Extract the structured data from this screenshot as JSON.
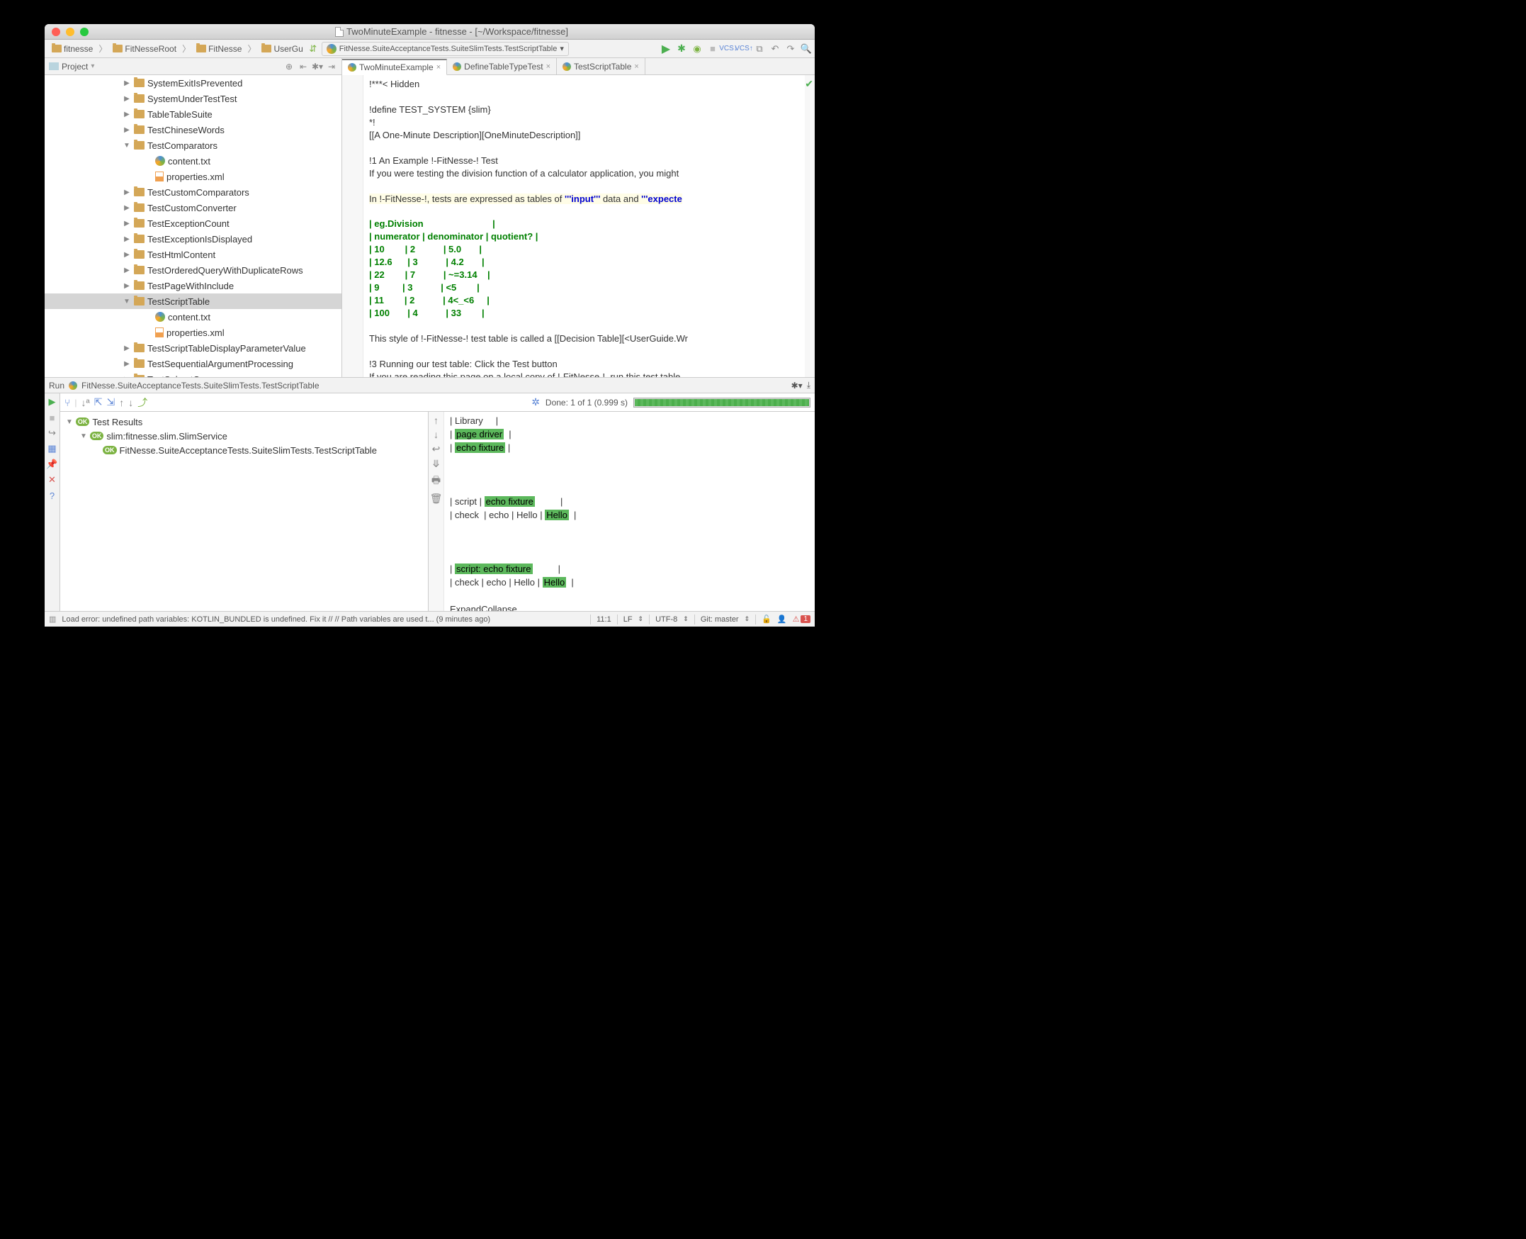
{
  "title": "TwoMinuteExample - fitnesse - [~/Workspace/fitnesse]",
  "breadcrumbs": [
    "fitnesse",
    "FitNesseRoot",
    "FitNesse",
    "UserGu"
  ],
  "runConfig": "FitNesse.SuiteAcceptanceTests.SuiteSlimTests.TestScriptTable",
  "projectPanel": {
    "label": "Project"
  },
  "tree": [
    {
      "indent": 110,
      "kind": "fold",
      "arrow": "▶",
      "name": "SystemExitIsPrevented"
    },
    {
      "indent": 110,
      "kind": "fold",
      "arrow": "▶",
      "name": "SystemUnderTestTest"
    },
    {
      "indent": 110,
      "kind": "fold",
      "arrow": "▶",
      "name": "TableTableSuite"
    },
    {
      "indent": 110,
      "kind": "fold",
      "arrow": "▶",
      "name": "TestChineseWords"
    },
    {
      "indent": 110,
      "kind": "fold",
      "arrow": "▼",
      "name": "TestComparators"
    },
    {
      "indent": 140,
      "kind": "txt",
      "arrow": "",
      "name": "content.txt"
    },
    {
      "indent": 140,
      "kind": "xml",
      "arrow": "",
      "name": "properties.xml"
    },
    {
      "indent": 110,
      "kind": "fold",
      "arrow": "▶",
      "name": "TestCustomComparators"
    },
    {
      "indent": 110,
      "kind": "fold",
      "arrow": "▶",
      "name": "TestCustomConverter"
    },
    {
      "indent": 110,
      "kind": "fold",
      "arrow": "▶",
      "name": "TestExceptionCount"
    },
    {
      "indent": 110,
      "kind": "fold",
      "arrow": "▶",
      "name": "TestExceptionIsDisplayed"
    },
    {
      "indent": 110,
      "kind": "fold",
      "arrow": "▶",
      "name": "TestHtmlContent"
    },
    {
      "indent": 110,
      "kind": "fold",
      "arrow": "▶",
      "name": "TestOrderedQueryWithDuplicateRows"
    },
    {
      "indent": 110,
      "kind": "fold",
      "arrow": "▶",
      "name": "TestPageWithInclude"
    },
    {
      "indent": 110,
      "kind": "fold",
      "arrow": "▼",
      "name": "TestScriptTable",
      "sel": true
    },
    {
      "indent": 140,
      "kind": "txt",
      "arrow": "",
      "name": "content.txt"
    },
    {
      "indent": 140,
      "kind": "xml",
      "arrow": "",
      "name": "properties.xml"
    },
    {
      "indent": 110,
      "kind": "fold",
      "arrow": "▶",
      "name": "TestScriptTableDisplayParameterValue"
    },
    {
      "indent": 110,
      "kind": "fold",
      "arrow": "▶",
      "name": "TestSequentialArgumentProcessing"
    },
    {
      "indent": 110,
      "kind": "fold",
      "arrow": "▶",
      "name": "TestSubsetQuery"
    }
  ],
  "editorTabs": [
    {
      "name": "TwoMinuteExample",
      "active": true
    },
    {
      "name": "DefineTableTypeTest",
      "active": false
    },
    {
      "name": "TestScriptTable",
      "active": false
    }
  ],
  "editor": {
    "l1": "!***< Hidden",
    "l2": "",
    "l3": "!define TEST_SYSTEM {slim}",
    "l4": "*!",
    "l5": "[[A One-Minute Description][OneMinuteDescription]]",
    "l6": "",
    "l7": "!1 An Example !-FitNesse-! Test",
    "l8": "If you were testing the division function of a calculator application, you might",
    "l9": "",
    "l10a": "In !-FitNesse-!, tests are expressed as tables of ",
    "l10b": "'''input'''",
    "l10c": " data and ",
    "l10d": "'''expecte",
    "t1": "| eg.Division                           |",
    "t2": "| numerator | denominator | quotient? |",
    "t3": "| 10        | 2           | 5.0       |",
    "t4": "| 12.6      | 3           | 4.2       |",
    "t5": "| 22        | 7           | ~=3.14    |",
    "t6": "| 9         | 3           | <5        |",
    "t7": "| 11        | 2           | 4<_<6     |",
    "t8": "| 100       | 4           | 33        |",
    "l20": "",
    "l21": "This style of !-FitNesse-! test table is called a [[Decision Table][<UserGuide.Wr",
    "l22": "",
    "l23": "!3 Running our test table: Click the Test button",
    "l24": "If you are reading this page on a local copy of !-FitNesse-!, run this test table"
  },
  "chart_data": {
    "type": "table",
    "title": "eg.Division",
    "columns": [
      "numerator",
      "denominator",
      "quotient?"
    ],
    "rows": [
      [
        "10",
        "2",
        "5.0"
      ],
      [
        "12.6",
        "3",
        "4.2"
      ],
      [
        "22",
        "7",
        "~=3.14"
      ],
      [
        "9",
        "3",
        "<5"
      ],
      [
        "11",
        "2",
        "4<_<6"
      ],
      [
        "100",
        "4",
        "33"
      ]
    ]
  },
  "runPanel": {
    "header": "FitNesse.SuiteAcceptanceTests.SuiteSlimTests.TestScriptTable",
    "label": "Run",
    "status": "Done: 1 of 1  (0.999 s)",
    "tree": [
      {
        "indent": 0,
        "text": "Test Results"
      },
      {
        "indent": 20,
        "text": "slim:fitnesse.slim.SlimService"
      },
      {
        "indent": 42,
        "text": "FitNesse.SuiteAcceptanceTests.SuiteSlimTests.TestScriptTable"
      }
    ],
    "out": {
      "r1a": "| Library     |",
      "r2a": "| ",
      "r2b": "page driver",
      "r2c": "  |",
      "r3a": "| ",
      "r3b": "echo fixture",
      "r3c": " |",
      "r4": "",
      "r5": "",
      "r6": "",
      "r7a": "| script | ",
      "r7b": "echo fixture",
      "r7c": "          |",
      "r8a": "| check  | echo | Hello | ",
      "r8b": "Hello",
      "r8c": "  |",
      "r9": "",
      "r10": "",
      "r11": "",
      "r12a": "| ",
      "r12b": "script: echo fixture",
      "r12c": "          |",
      "r13a": "| check | echo | Hello | ",
      "r13b": "Hello",
      "r13c": "  |",
      "r14": "",
      "r15": "ExpandCollapse"
    }
  },
  "statusbar": {
    "msg": "Load error: undefined path variables: KOTLIN_BUNDLED is undefined. Fix it // // Path variables are used t... (9 minutes ago)",
    "pos": "11:1",
    "lf": "LF",
    "enc": "UTF-8",
    "git": "Git: master",
    "err": "1"
  }
}
